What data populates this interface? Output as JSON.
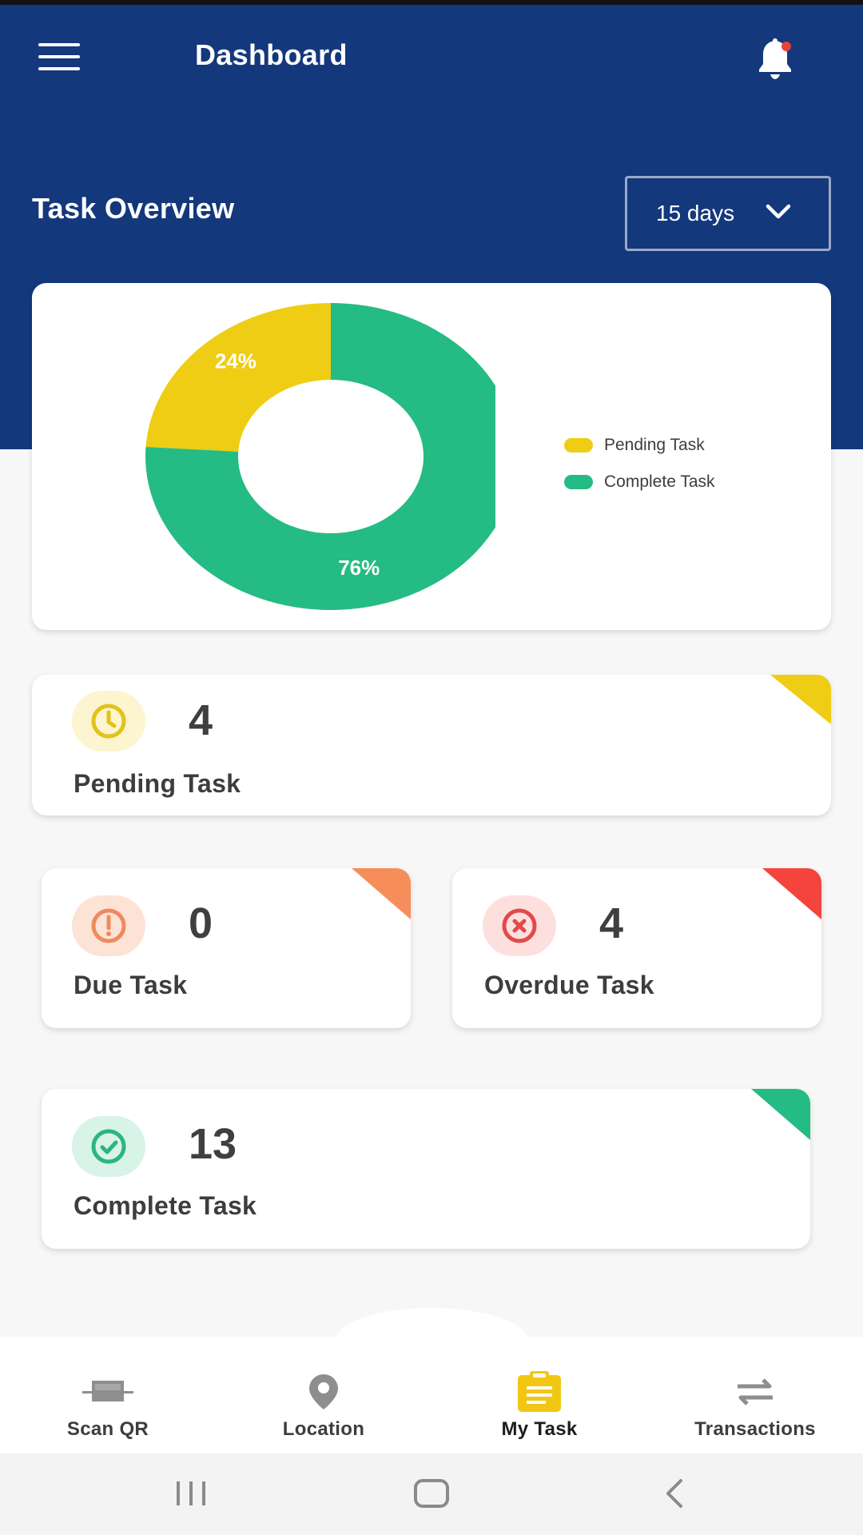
{
  "header": {
    "title": "Dashboard",
    "section_title": "Task Overview",
    "period_select": "15 days",
    "menu_icon": "hamburger-menu-icon",
    "notification_icon": "bell-icon",
    "notification_dot": true
  },
  "colors": {
    "header_bg": "#14387c",
    "pending": "#eecd14",
    "complete": "#25bb84",
    "due": "#f68d5b",
    "overdue": "#f4443c",
    "accent": "#f2c714"
  },
  "chart_data": {
    "type": "pie",
    "donut": true,
    "categories": [
      "Pending Task",
      "Complete Task"
    ],
    "values": [
      24,
      76
    ],
    "labels": [
      "24%",
      "76%"
    ],
    "colors": [
      "#eecd14",
      "#25bb84"
    ],
    "legend_position": "right"
  },
  "stats": {
    "pending": {
      "value": "4",
      "label": "Pending Task",
      "icon": "clock-icon"
    },
    "due": {
      "value": "0",
      "label": "Due Task",
      "icon": "exclamation-circle-icon"
    },
    "overdue": {
      "value": "4",
      "label": "Overdue Task",
      "icon": "x-circle-icon"
    },
    "complete": {
      "value": "13",
      "label": "Complete Task",
      "icon": "check-circle-icon"
    }
  },
  "bottom_nav": {
    "items": [
      {
        "label": "Scan QR",
        "icon": "scan-qr-icon",
        "active": false
      },
      {
        "label": "Location",
        "icon": "location-pin-icon",
        "active": false
      },
      {
        "label": "My Task",
        "icon": "clipboard-icon",
        "active": true
      },
      {
        "label": "Transactions",
        "icon": "transfer-arrows-icon",
        "active": false
      }
    ]
  },
  "system_nav": {
    "recents_icon": "recents-icon",
    "home_icon": "home-icon",
    "back_icon": "back-icon"
  }
}
